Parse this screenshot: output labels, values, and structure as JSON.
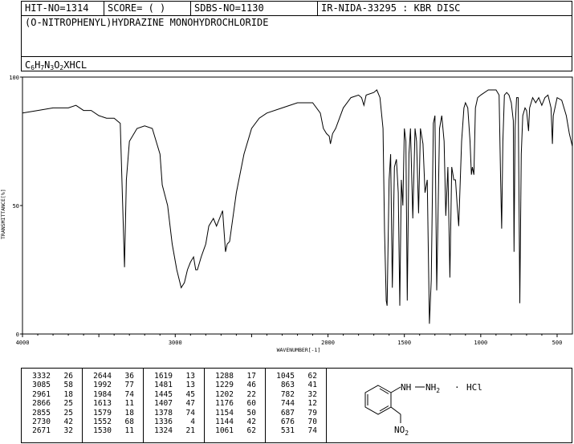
{
  "header": {
    "hit_no": "HIT-NO=1314",
    "score": "SCORE=  (   )",
    "sdbs_no": "SDBS-NO=1130",
    "ir_nida": "IR-NIDA-33295 : KBR DISC",
    "compound_name": "(O-NITROPHENYL)HYDRAZINE MONOHYDROCHLORIDE",
    "formula": {
      "c": "C",
      "c_n": "6",
      "h": "H",
      "h_n": "7",
      "n": "N",
      "n_n": "3",
      "o": "O",
      "o_n": "2",
      "rest": "XHCL"
    }
  },
  "chart_data": {
    "type": "line",
    "xlabel": "WAVENUMBER[-1]",
    "ylabel": "TRANSMITTANCE[%]",
    "xlim": [
      4000,
      400
    ],
    "ylim": [
      0,
      100
    ],
    "x_ticks": [
      4000,
      3000,
      2000,
      1500,
      1000,
      500
    ],
    "y_ticks": [
      0,
      50,
      100
    ],
    "series": [
      {
        "points": [
          [
            4000,
            86
          ],
          [
            3900,
            87
          ],
          [
            3800,
            88
          ],
          [
            3700,
            88
          ],
          [
            3650,
            89
          ],
          [
            3600,
            87
          ],
          [
            3550,
            87
          ],
          [
            3500,
            85
          ],
          [
            3450,
            84
          ],
          [
            3400,
            84
          ],
          [
            3360,
            82
          ],
          [
            3332,
            26
          ],
          [
            3320,
            60
          ],
          [
            3300,
            75
          ],
          [
            3250,
            80
          ],
          [
            3200,
            81
          ],
          [
            3150,
            80
          ],
          [
            3100,
            70
          ],
          [
            3085,
            58
          ],
          [
            3050,
            50
          ],
          [
            3020,
            35
          ],
          [
            2990,
            25
          ],
          [
            2961,
            18
          ],
          [
            2940,
            20
          ],
          [
            2920,
            25
          ],
          [
            2900,
            28
          ],
          [
            2880,
            30
          ],
          [
            2866,
            25
          ],
          [
            2855,
            25
          ],
          [
            2830,
            30
          ],
          [
            2800,
            35
          ],
          [
            2780,
            42
          ],
          [
            2750,
            45
          ],
          [
            2730,
            42
          ],
          [
            2710,
            45
          ],
          [
            2690,
            48
          ],
          [
            2671,
            32
          ],
          [
            2660,
            35
          ],
          [
            2644,
            36
          ],
          [
            2600,
            55
          ],
          [
            2550,
            70
          ],
          [
            2500,
            80
          ],
          [
            2450,
            84
          ],
          [
            2400,
            86
          ],
          [
            2300,
            88
          ],
          [
            2200,
            90
          ],
          [
            2100,
            90
          ],
          [
            2050,
            86
          ],
          [
            2030,
            80
          ],
          [
            2010,
            78
          ],
          [
            1992,
            77
          ],
          [
            1984,
            74
          ],
          [
            1970,
            78
          ],
          [
            1950,
            80
          ],
          [
            1900,
            88
          ],
          [
            1850,
            92
          ],
          [
            1800,
            93
          ],
          [
            1780,
            92
          ],
          [
            1765,
            89
          ],
          [
            1750,
            93
          ],
          [
            1700,
            94
          ],
          [
            1680,
            95
          ],
          [
            1660,
            92
          ],
          [
            1640,
            80
          ],
          [
            1630,
            40
          ],
          [
            1619,
            13
          ],
          [
            1613,
            11
          ],
          [
            1600,
            60
          ],
          [
            1590,
            70
          ],
          [
            1579,
            18
          ],
          [
            1565,
            65
          ],
          [
            1552,
            68
          ],
          [
            1540,
            55
          ],
          [
            1530,
            11
          ],
          [
            1520,
            60
          ],
          [
            1510,
            50
          ],
          [
            1500,
            80
          ],
          [
            1490,
            75
          ],
          [
            1481,
            13
          ],
          [
            1470,
            70
          ],
          [
            1460,
            80
          ],
          [
            1445,
            45
          ],
          [
            1430,
            80
          ],
          [
            1420,
            75
          ],
          [
            1407,
            47
          ],
          [
            1395,
            80
          ],
          [
            1378,
            74
          ],
          [
            1365,
            55
          ],
          [
            1350,
            60
          ],
          [
            1336,
            4
          ],
          [
            1324,
            21
          ],
          [
            1310,
            82
          ],
          [
            1300,
            85
          ],
          [
            1288,
            17
          ],
          [
            1270,
            80
          ],
          [
            1255,
            85
          ],
          [
            1240,
            75
          ],
          [
            1229,
            46
          ],
          [
            1215,
            65
          ],
          [
            1202,
            22
          ],
          [
            1190,
            65
          ],
          [
            1176,
            60
          ],
          [
            1165,
            60
          ],
          [
            1154,
            50
          ],
          [
            1144,
            42
          ],
          [
            1125,
            75
          ],
          [
            1110,
            88
          ],
          [
            1100,
            90
          ],
          [
            1085,
            88
          ],
          [
            1070,
            75
          ],
          [
            1061,
            62
          ],
          [
            1055,
            65
          ],
          [
            1045,
            62
          ],
          [
            1035,
            88
          ],
          [
            1020,
            92
          ],
          [
            1000,
            93
          ],
          [
            950,
            95
          ],
          [
            900,
            95
          ],
          [
            880,
            93
          ],
          [
            870,
            60
          ],
          [
            863,
            41
          ],
          [
            855,
            75
          ],
          [
            845,
            93
          ],
          [
            830,
            94
          ],
          [
            815,
            93
          ],
          [
            800,
            90
          ],
          [
            787,
            83
          ],
          [
            782,
            32
          ],
          [
            775,
            80
          ],
          [
            765,
            92
          ],
          [
            755,
            92
          ],
          [
            744,
            12
          ],
          [
            735,
            70
          ],
          [
            725,
            85
          ],
          [
            710,
            88
          ],
          [
            700,
            87
          ],
          [
            687,
            79
          ],
          [
            680,
            88
          ],
          [
            660,
            92
          ],
          [
            640,
            90
          ],
          [
            620,
            92
          ],
          [
            600,
            89
          ],
          [
            580,
            92
          ],
          [
            560,
            93
          ],
          [
            540,
            88
          ],
          [
            531,
            74
          ],
          [
            525,
            85
          ],
          [
            500,
            92
          ],
          [
            470,
            91
          ],
          [
            440,
            85
          ],
          [
            420,
            78
          ],
          [
            400,
            73
          ]
        ]
      }
    ]
  },
  "peak_table": {
    "columns": [
      [
        [
          "3332",
          "26"
        ],
        [
          "3085",
          "58"
        ],
        [
          "2961",
          "18"
        ],
        [
          "2866",
          "25"
        ],
        [
          "2855",
          "25"
        ],
        [
          "2730",
          "42"
        ],
        [
          "2671",
          "32"
        ]
      ],
      [
        [
          "2644",
          "36"
        ],
        [
          "1992",
          "77"
        ],
        [
          "1984",
          "74"
        ],
        [
          "1613",
          "11"
        ],
        [
          "1579",
          "18"
        ],
        [
          "1552",
          "68"
        ],
        [
          "1530",
          "11"
        ]
      ],
      [
        [
          "1619",
          "13"
        ],
        [
          "1481",
          "13"
        ],
        [
          "1445",
          "45"
        ],
        [
          "1407",
          "47"
        ],
        [
          "1378",
          "74"
        ],
        [
          "1336",
          "4"
        ],
        [
          "1324",
          "21"
        ]
      ],
      [
        [
          "1288",
          "17"
        ],
        [
          "1229",
          "46"
        ],
        [
          "1202",
          "22"
        ],
        [
          "1176",
          "60"
        ],
        [
          "1154",
          "50"
        ],
        [
          "1144",
          "42"
        ],
        [
          "1061",
          "62"
        ]
      ],
      [
        [
          "1045",
          "62"
        ],
        [
          "863",
          "41"
        ],
        [
          "782",
          "32"
        ],
        [
          "744",
          "12"
        ],
        [
          "687",
          "79"
        ],
        [
          "676",
          "70"
        ],
        [
          "531",
          "74"
        ]
      ]
    ]
  },
  "structure": {
    "nh": "NH",
    "nh2": "NH",
    "nh2_sub": "2",
    "dot": "·",
    "hcl": "HCl",
    "no2": "NO",
    "no2_sub": "2"
  }
}
